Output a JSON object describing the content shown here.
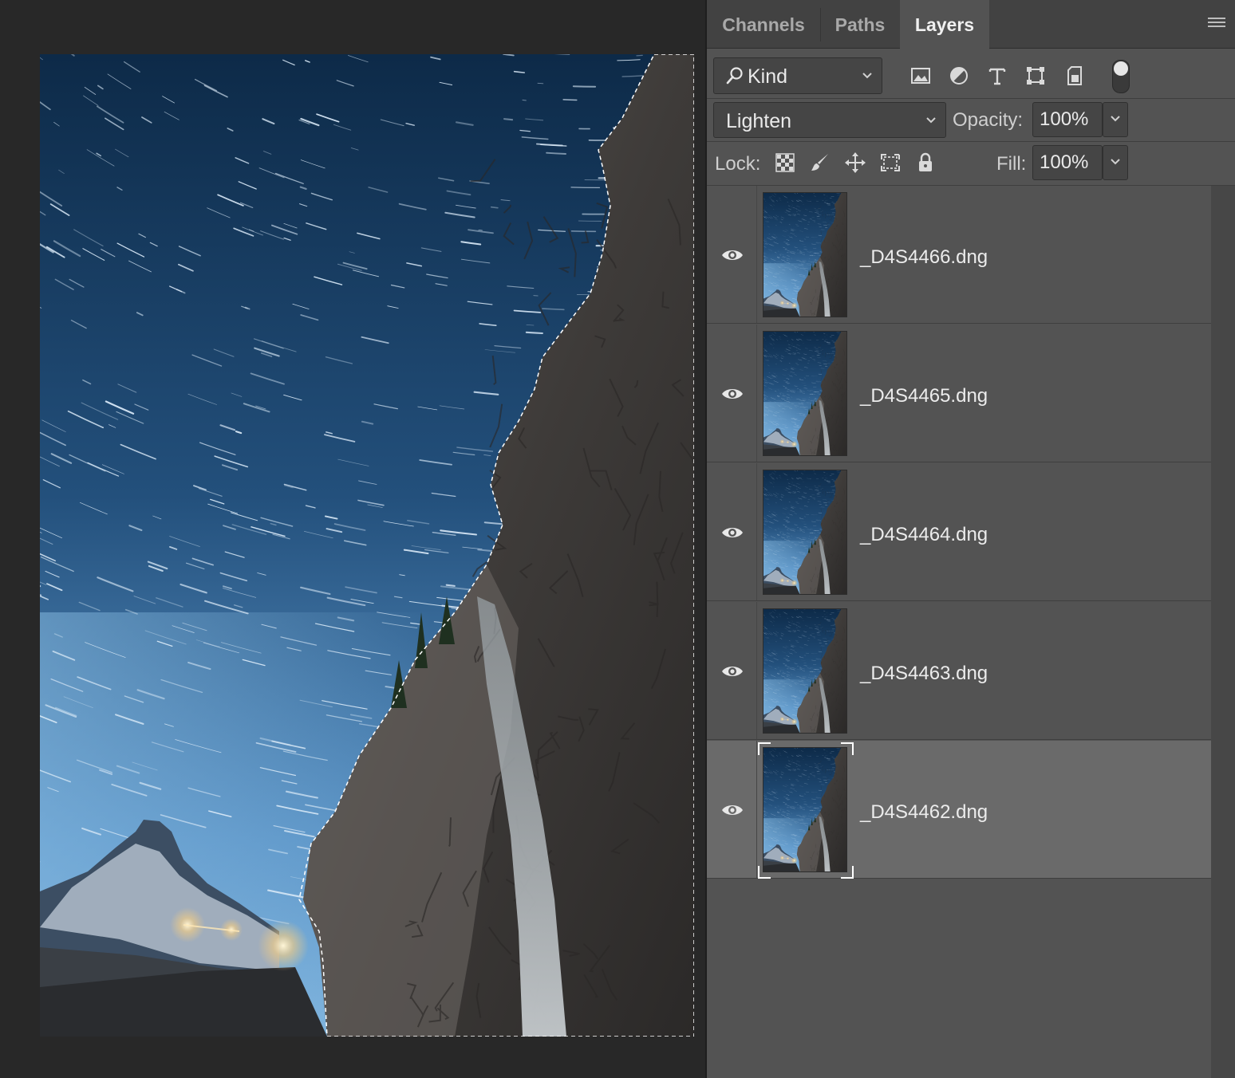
{
  "panel": {
    "tabs": [
      {
        "label": "Channels",
        "active": false
      },
      {
        "label": "Paths",
        "active": false
      },
      {
        "label": "Layers",
        "active": true
      }
    ],
    "menu_icon": "hamburger-menu-icon"
  },
  "filter": {
    "kind_label": "Kind",
    "icons": [
      "pixel-layer-filter-icon",
      "adjustment-layer-filter-icon",
      "type-layer-filter-icon",
      "shape-layer-filter-icon",
      "smart-object-filter-icon"
    ]
  },
  "blend": {
    "mode": "Lighten",
    "opacity_label": "Opacity:",
    "opacity_value": "100%"
  },
  "lock": {
    "label": "Lock:",
    "icons": [
      "lock-transparent-pixels-icon",
      "lock-image-pixels-icon",
      "lock-position-icon",
      "lock-artboard-icon",
      "lock-all-icon"
    ],
    "fill_label": "Fill:",
    "fill_value": "100%"
  },
  "layers": [
    {
      "name": "_D4S4466.dng",
      "visible": true,
      "selected": false
    },
    {
      "name": "_D4S4465.dng",
      "visible": true,
      "selected": false
    },
    {
      "name": "_D4S4464.dng",
      "visible": true,
      "selected": false
    },
    {
      "name": "_D4S4463.dng",
      "visible": true,
      "selected": false
    },
    {
      "name": "_D4S4462.dng",
      "visible": true,
      "selected": true
    }
  ],
  "colors": {
    "panel_bg": "#535353",
    "selected_row": "#6a6a6a",
    "canvas_bg": "#282828",
    "sky_top": "#0d2a48",
    "sky_bottom": "#6ea7d6",
    "rock": "#4a4744"
  }
}
